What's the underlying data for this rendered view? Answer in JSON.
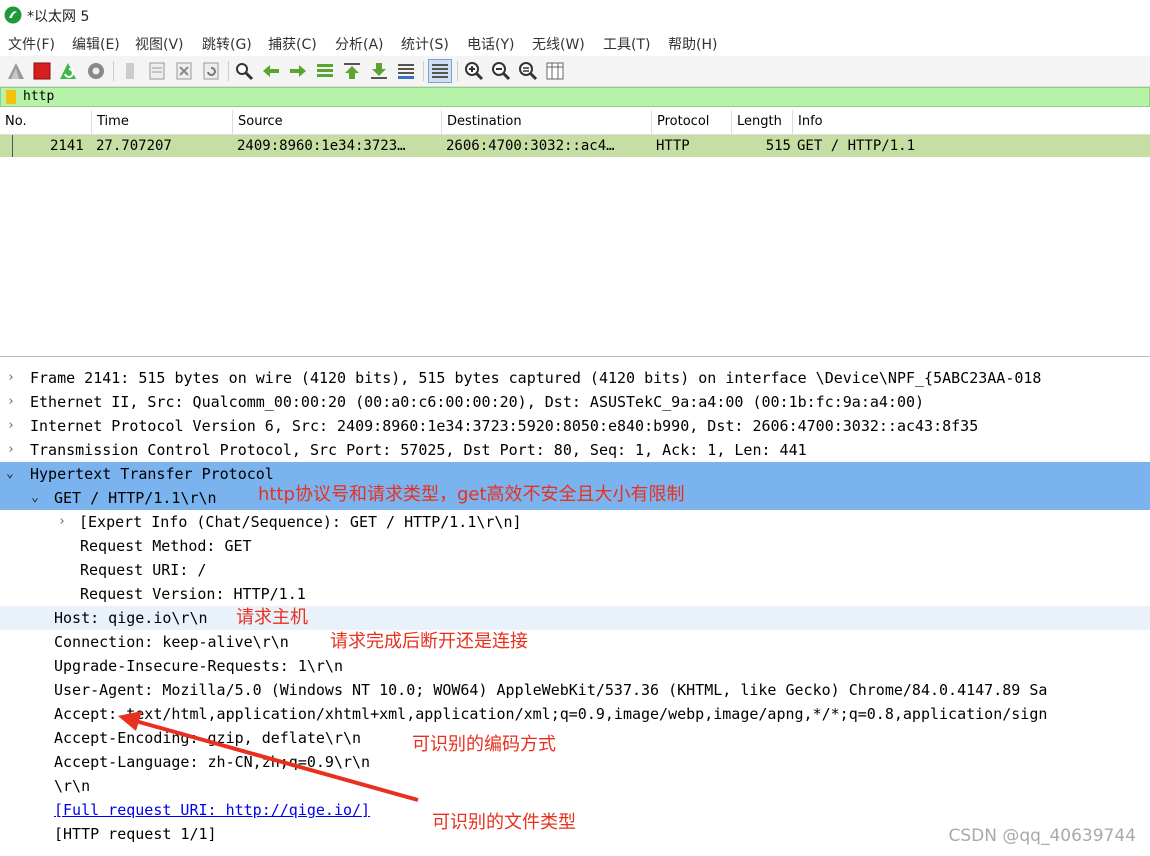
{
  "window": {
    "title": "*以太网 5"
  },
  "menu": [
    "文件(F)",
    "编辑(E)",
    "视图(V)",
    "跳转(G)",
    "捕获(C)",
    "分析(A)",
    "统计(S)",
    "电话(Y)",
    "无线(W)",
    "工具(T)",
    "帮助(H)"
  ],
  "toolbar": {
    "icons": [
      "shark-fin-start-icon",
      "stop-capture-icon",
      "restart-capture-icon",
      "capture-options-icon",
      "open-file-icon",
      "save-file-icon",
      "close-file-icon",
      "reload-file-icon",
      "find-packet-icon",
      "go-back-icon",
      "go-forward-icon",
      "go-to-packet-icon",
      "go-first-icon",
      "go-last-icon",
      "auto-scroll-icon",
      "colorize-icon",
      "zoom-in-icon",
      "zoom-out-icon",
      "normal-size-icon",
      "resize-columns-icon"
    ]
  },
  "filter": {
    "value": "http"
  },
  "packet_list": {
    "columns": [
      "No.",
      "Time",
      "Source",
      "Destination",
      "Protocol",
      "Length",
      "Info"
    ],
    "rows": [
      {
        "no": "2141",
        "time": "27.707207",
        "source": "2409:8960:1e34:3723…",
        "destination": "2606:4700:3032::ac4…",
        "protocol": "HTTP",
        "length": "515",
        "info": "GET / HTTP/1.1"
      }
    ]
  },
  "details": {
    "frame": "Frame 2141: 515 bytes on wire (4120 bits), 515 bytes captured (4120 bits) on interface \\Device\\NPF_{5ABC23AA-018",
    "ethernet": "Ethernet II, Src: Qualcomm_00:00:20 (00:a0:c6:00:00:20), Dst: ASUSTekC_9a:a4:00 (00:1b:fc:9a:a4:00)",
    "ipv6": "Internet Protocol Version 6, Src: 2409:8960:1e34:3723:5920:8050:e840:b990, Dst: 2606:4700:3032::ac43:8f35",
    "tcp": "Transmission Control Protocol, Src Port: 57025, Dst Port: 80, Seq: 1, Ack: 1, Len: 441",
    "http": "Hypertext Transfer Protocol",
    "request_line": "GET / HTTP/1.1\\r\\n",
    "expert_info": "[Expert Info (Chat/Sequence): GET / HTTP/1.1\\r\\n]",
    "request_method": "Request Method: GET",
    "request_uri": "Request URI: /",
    "request_version": "Request Version: HTTP/1.1",
    "host": "Host: qige.io\\r\\n",
    "connection": "Connection: keep-alive\\r\\n",
    "upgrade": "Upgrade-Insecure-Requests: 1\\r\\n",
    "user_agent": "User-Agent: Mozilla/5.0 (Windows NT 10.0; WOW64) AppleWebKit/537.36 (KHTML, like Gecko) Chrome/84.0.4147.89 Sa",
    "accept": "Accept: text/html,application/xhtml+xml,application/xml;q=0.9,image/webp,image/apng,*/*;q=0.8,application/sign",
    "accept_encoding": "Accept-Encoding: gzip, deflate\\r\\n",
    "accept_language": "Accept-Language: zh-CN,zh;q=0.9\\r\\n",
    "crlf": "\\r\\n",
    "full_uri": "[Full request URI: http://qige.io/]",
    "http_request": "[HTTP request 1/1]"
  },
  "annotations": {
    "request_line": "http协议号和请求类型，get高效不安全且大小有限制",
    "host": "请求主机",
    "connection": "请求完成后断开还是连接",
    "encoding": "可识别的编码方式",
    "file_type": "可识别的文件类型"
  },
  "watermark": "CSDN @qq_40639744",
  "colors": {
    "filter_bg": "#b6f3a8",
    "row_highlight": "#c6dda3",
    "selected": "#7bb3ef",
    "annotation": "#e8301f"
  }
}
